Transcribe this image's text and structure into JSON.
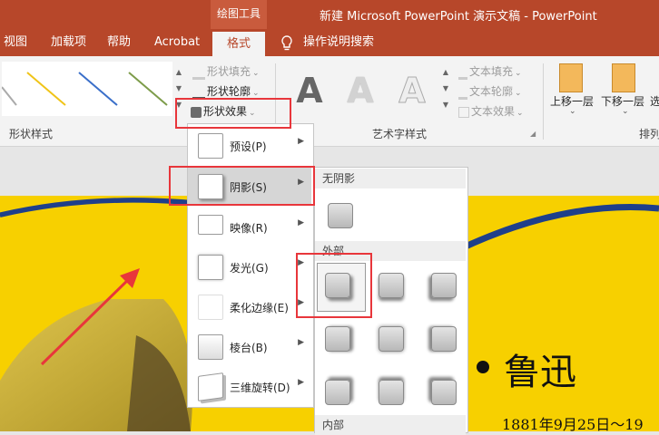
{
  "titlebar": {
    "drawing_tools": "绘图工具",
    "document_title": "新建 Microsoft PowerPoint 演示文稿  -  PowerPoint"
  },
  "tabs": [
    {
      "label": "视图"
    },
    {
      "label": "加载项"
    },
    {
      "label": "帮助"
    },
    {
      "label": "Acrobat"
    },
    {
      "label": "格式"
    }
  ],
  "tell_me": "操作说明搜索",
  "ribbon": {
    "shape_fill": "形状填充",
    "shape_outline": "形状轮廓",
    "shape_effects": "形状效果",
    "text_fill": "文本填充",
    "text_outline": "文本轮廓",
    "text_effects": "文本效果",
    "wordart_letter": "A",
    "bring_forward": "上移一层",
    "send_backward": "下移一层",
    "wrap_partial": "选",
    "group_shape_styles": "形状样式",
    "group_wordart_styles": "艺术字样式",
    "group_arrange_partial": "排列"
  },
  "effects_menu": {
    "items": [
      {
        "label": "预设(P)"
      },
      {
        "label": "阴影(S)"
      },
      {
        "label": "映像(R)"
      },
      {
        "label": "发光(G)"
      },
      {
        "label": "柔化边缘(E)"
      },
      {
        "label": "棱台(B)"
      },
      {
        "label": "三维旋转(D)"
      }
    ]
  },
  "shadow_submenu": {
    "no_shadow": "无阴影",
    "outer": "外部",
    "inner": "内部"
  },
  "slide": {
    "title": "鲁迅",
    "date": "1881年9月25日～19"
  },
  "colors": {
    "accent": "#b7472a",
    "annotation_red": "#e8363b",
    "slide_yellow": "#f7d000",
    "slide_curve": "#1f3f8a"
  }
}
